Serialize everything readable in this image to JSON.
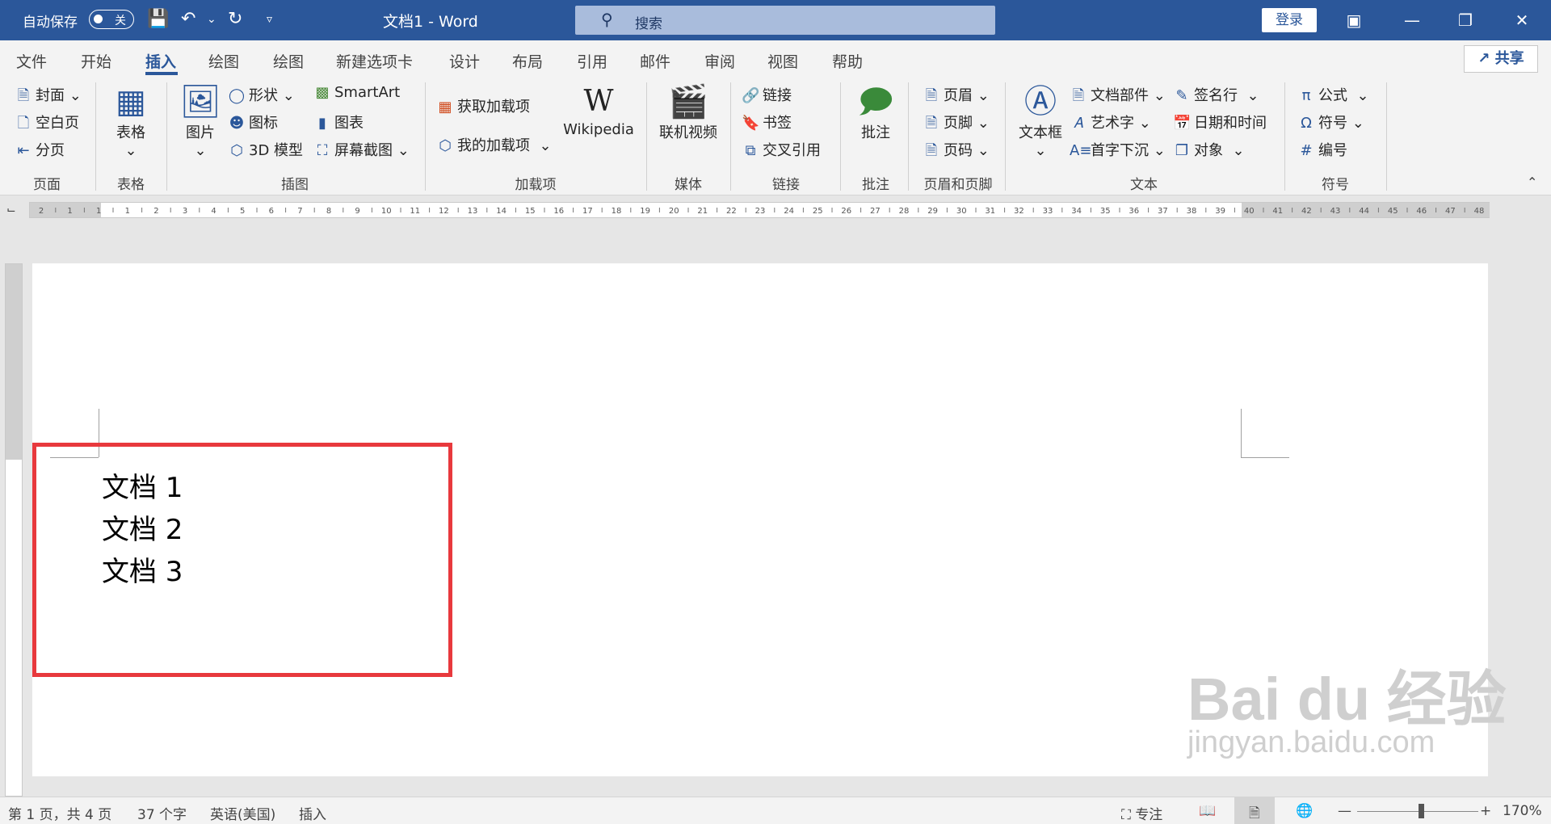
{
  "titlebar": {
    "autosave_label": "自动保存",
    "autosave_state": "关",
    "document_title": "文档1  -  Word",
    "search_placeholder": "搜索",
    "login_label": "登录"
  },
  "tabs": [
    "文件",
    "开始",
    "插入",
    "绘图",
    "绘图",
    "新建选项卡",
    "设计",
    "布局",
    "引用",
    "邮件",
    "审阅",
    "视图",
    "帮助"
  ],
  "active_tab": "插入",
  "share_label": "共享",
  "ribbon": {
    "pages": {
      "cover": "封面",
      "blank": "空白页",
      "break": "分页",
      "group": "页面"
    },
    "tables": {
      "table": "表格",
      "group": "表格"
    },
    "illustrations": {
      "pictures": "图片",
      "shapes": "形状",
      "icons": "图标",
      "models3d": "3D 模型",
      "smartart": "SmartArt",
      "chart": "图表",
      "screenshot": "屏幕截图",
      "group": "插图"
    },
    "addins": {
      "get": "获取加载项",
      "my": "我的加载项",
      "wikipedia": "Wikipedia",
      "group": "加载项"
    },
    "media": {
      "online_video": "联机视频",
      "group": "媒体"
    },
    "links": {
      "link": "链接",
      "bookmark": "书签",
      "cross_ref": "交叉引用",
      "group": "链接"
    },
    "comments": {
      "comment": "批注",
      "group": "批注"
    },
    "header_footer": {
      "header": "页眉",
      "footer": "页脚",
      "page_number": "页码",
      "group": "页眉和页脚"
    },
    "text": {
      "textbox": "文本框",
      "quick_parts": "文档部件",
      "wordart": "艺术字",
      "dropcap": "首字下沉",
      "signature": "签名行",
      "datetime": "日期和时间",
      "object": "对象",
      "group": "文本"
    },
    "symbols": {
      "equation": "公式",
      "symbol": "符号",
      "number": "编号",
      "group": "符号"
    }
  },
  "ruler_numbers": [
    "2",
    "1",
    "1",
    "1",
    "2",
    "3",
    "4",
    "5",
    "6",
    "7",
    "8",
    "9",
    "10",
    "11",
    "12",
    "13",
    "14",
    "15",
    "16",
    "17",
    "18",
    "19",
    "20",
    "21",
    "22",
    "23",
    "24",
    "25",
    "26",
    "27",
    "28",
    "29",
    "30",
    "31",
    "32",
    "33",
    "34",
    "35",
    "36",
    "37",
    "38",
    "39",
    "40",
    "41",
    "42",
    "43",
    "44",
    "45",
    "46",
    "47",
    "48"
  ],
  "document": {
    "lines": [
      "文档 1",
      "文档 2",
      "文档 3"
    ]
  },
  "watermark": {
    "line1": "Bai du 经验",
    "line2": "jingyan.baidu.com"
  },
  "statusbar": {
    "page": "第 1 页，共 4 页",
    "words": "37 个字",
    "language": "英语(美国)",
    "mode": "插入",
    "focus": "专注",
    "zoom": "170%"
  },
  "colors": {
    "brand": "#2b579a",
    "highlight": "#e8393d"
  }
}
